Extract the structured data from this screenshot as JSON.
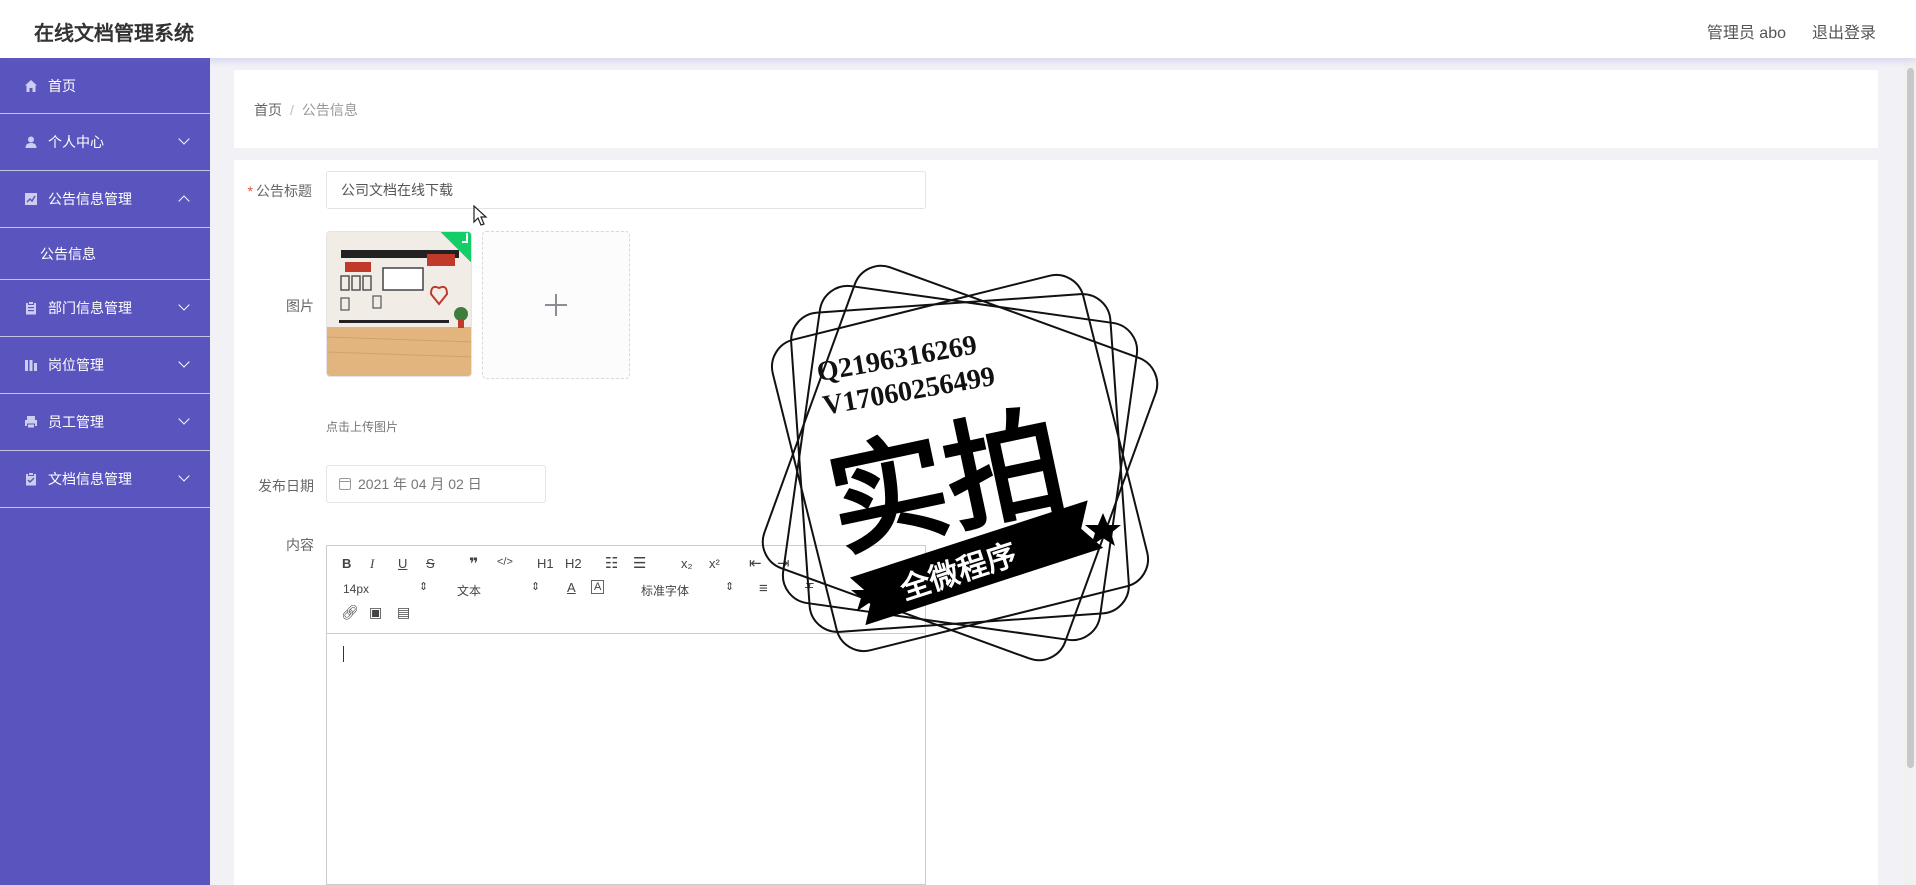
{
  "header": {
    "app_title": "在线文档管理系统",
    "user": "管理员 abo",
    "logout": "退出登录"
  },
  "sidebar": {
    "items": [
      {
        "label": "首页",
        "icon": "home-icon"
      },
      {
        "label": "个人中心",
        "icon": "user-icon"
      },
      {
        "label": "公告信息管理",
        "icon": "chart-icon",
        "expanded": true
      },
      {
        "label": "公告信息"
      },
      {
        "label": "部门信息管理",
        "icon": "clipboard-icon"
      },
      {
        "label": "岗位管理",
        "icon": "columns-icon"
      },
      {
        "label": "员工管理",
        "icon": "printer-icon"
      },
      {
        "label": "文档信息管理",
        "icon": "checklist-icon"
      }
    ],
    "background_color": "#5a55be"
  },
  "breadcrumb": {
    "home": "首页",
    "separator": "/",
    "current": "公告信息"
  },
  "form": {
    "title_label": "公告标题",
    "title_required_mark": "*",
    "title_value": "公司文档在线下载",
    "image_label": "图片",
    "upload_hint": "点击上传图片",
    "date_label": "发布日期",
    "date_value": "2021 年 04 月 02 日",
    "content_label": "内容"
  },
  "editor": {
    "font_size": "14px",
    "header_select": "文本",
    "font_family": "标准字体",
    "buttons": [
      "B",
      "I",
      "U",
      "S",
      "H1",
      "H2",
      "x₂",
      "x²"
    ]
  },
  "stamp": {
    "line1": "Q2196316269",
    "line2": "V17060256499",
    "main": "实拍",
    "banner": "全微程序"
  }
}
